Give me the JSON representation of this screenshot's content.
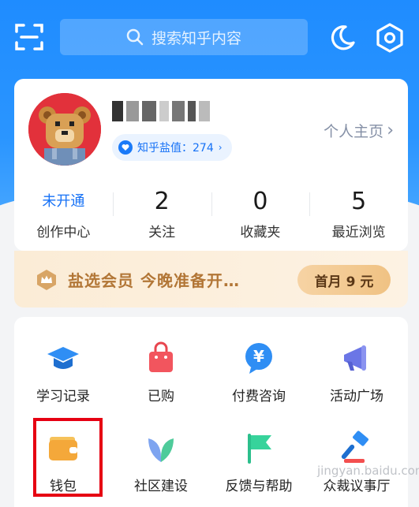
{
  "search": {
    "placeholder": "搜索知乎内容"
  },
  "profile": {
    "salt_label": "知乎盐值：274",
    "homepage_label": "个人主页"
  },
  "stats": [
    {
      "value": "未开通",
      "label": "创作中心"
    },
    {
      "value": "2",
      "label": "关注"
    },
    {
      "value": "0",
      "label": "收藏夹"
    },
    {
      "value": "5",
      "label": "最近浏览"
    }
  ],
  "vip": {
    "text": "盐选会员 今晚准备开…",
    "button": "首月 9 元"
  },
  "tools": [
    {
      "label": "学习记录",
      "icon": "graduation-cap-icon"
    },
    {
      "label": "已购",
      "icon": "shopping-bag-icon"
    },
    {
      "label": "付费咨询",
      "icon": "yen-chat-icon"
    },
    {
      "label": "活动广场",
      "icon": "megaphone-icon"
    },
    {
      "label": "钱包",
      "icon": "wallet-icon"
    },
    {
      "label": "社区建设",
      "icon": "sprout-icon"
    },
    {
      "label": "反馈与帮助",
      "icon": "flag-icon"
    },
    {
      "label": "众裁议事厅",
      "icon": "gavel-icon"
    }
  ],
  "watermark": "jingyan.baidu.com",
  "colors": {
    "brand_blue": "#1772f6",
    "highlight_red": "#e60012"
  }
}
